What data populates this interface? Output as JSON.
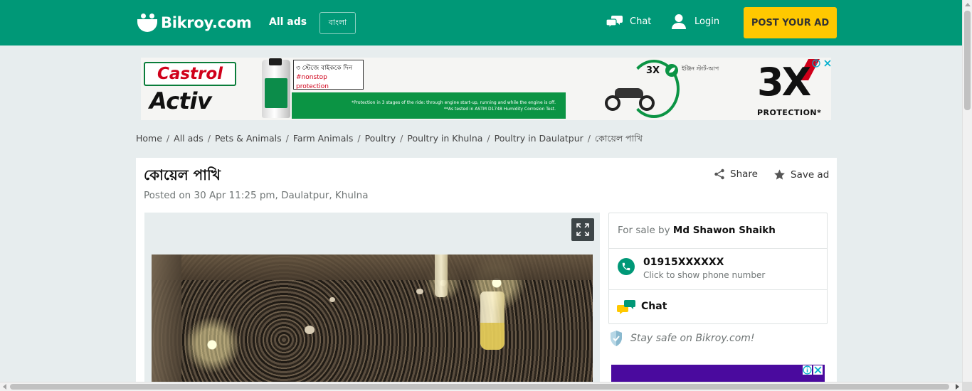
{
  "header": {
    "logo_text": "Bikroy.com",
    "all_ads": "All ads",
    "language_toggle": "বাংলা",
    "chat": "Chat",
    "login": "Login",
    "post_ad": "POST YOUR AD",
    "brand_color": "#009877",
    "accent_color": "#ffc800"
  },
  "banner_ad": {
    "brand_top": "Castrol",
    "brand_bottom": "Activ",
    "tag_line_1": "৩ স্টেজে বাইককে দিন",
    "tag_line_2": "#nonstop protection",
    "fine_print_1": "*Protection in 3 stages of the ride: through engine start-up, running and while the engine is off.",
    "fine_print_2": "**As tested in ASTM D1748 Humidity Corrosion Test.",
    "badge_small": "3X",
    "bengali_note": "ইঞ্জিন স্টার্ট-আপ",
    "big_claim": "3X",
    "big_claim_sub": "PROTECTION*"
  },
  "breadcrumb": [
    "Home",
    "All ads",
    "Pets & Animals",
    "Farm Animals",
    "Poultry",
    "Poultry in Khulna",
    "Poultry in Daulatpur",
    "কোয়েল পাখি"
  ],
  "listing": {
    "title": "কোয়েল পাখি",
    "posted": "Posted on 30 Apr 11:25 pm, Daulatpur, Khulna",
    "share": "Share",
    "save": "Save ad"
  },
  "seller": {
    "for_sale_by": "For sale by",
    "name": "Md Shawon Shaikh",
    "phone": "01915XXXXXX",
    "phone_hint": "Click to show phone number",
    "chat": "Chat"
  },
  "safety": {
    "text": "Stay safe on Bikroy.com!"
  }
}
